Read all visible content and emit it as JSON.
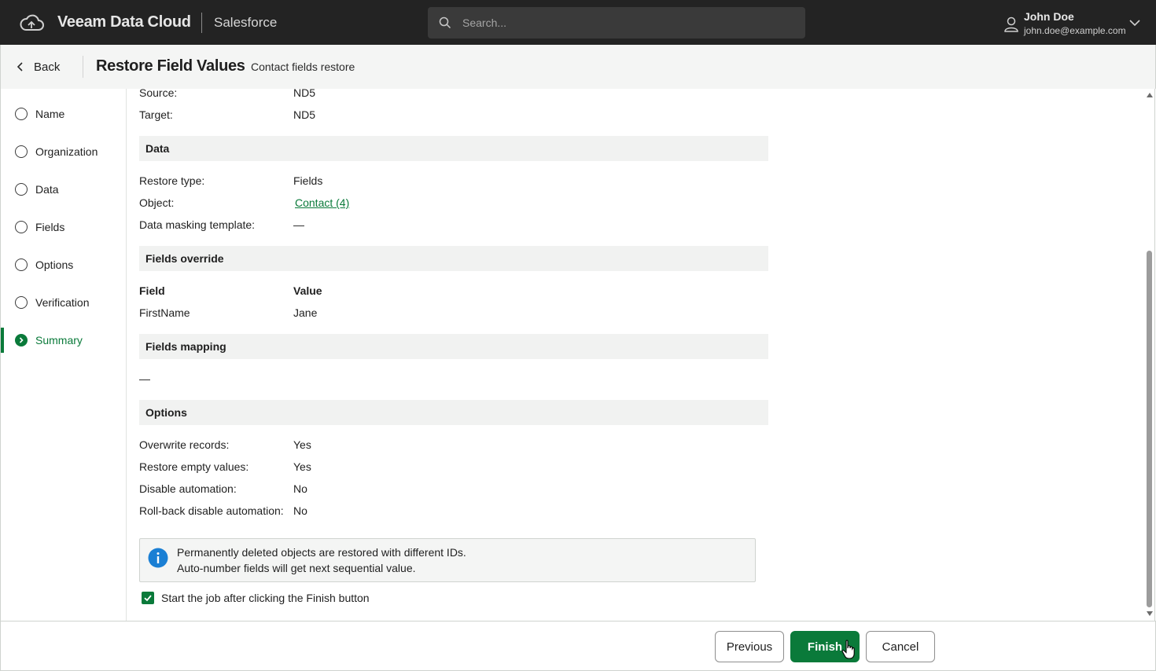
{
  "topbar": {
    "brand": "Veeam Data Cloud",
    "product": "Salesforce",
    "search_placeholder": "Search...",
    "user_name": "John Doe",
    "user_email": "john.doe@example.com"
  },
  "header": {
    "back_label": "Back",
    "title": "Restore Field Values",
    "subtitle": "Contact fields restore"
  },
  "steps": [
    {
      "label": "Name",
      "active": false
    },
    {
      "label": "Organization",
      "active": false
    },
    {
      "label": "Data",
      "active": false
    },
    {
      "label": "Fields",
      "active": false
    },
    {
      "label": "Options",
      "active": false
    },
    {
      "label": "Verification",
      "active": false
    },
    {
      "label": "Summary",
      "active": true
    }
  ],
  "summary": {
    "source": {
      "key": "Source:",
      "value": "ND5"
    },
    "target": {
      "key": "Target:",
      "value": "ND5"
    },
    "data_section": "Data",
    "restore_type": {
      "key": "Restore type:",
      "value": "Fields"
    },
    "object": {
      "key": "Object:",
      "value": "Contact (4)"
    },
    "masking": {
      "key": "Data masking template:",
      "value": "—"
    },
    "override_section": "Fields override",
    "override_headers": {
      "field": "Field",
      "value": "Value"
    },
    "override_rows": [
      {
        "field": "FirstName",
        "value": "Jane"
      }
    ],
    "mapping_section": "Fields mapping",
    "mapping_value": "—",
    "options_section": "Options",
    "overwrite": {
      "key": "Overwrite records:",
      "value": "Yes"
    },
    "empty_values": {
      "key": "Restore empty values:",
      "value": "Yes"
    },
    "disable_automation": {
      "key": "Disable automation:",
      "value": "No"
    },
    "rollback_automation": {
      "key": "Roll-back disable automation:",
      "value": "No"
    }
  },
  "info": {
    "line1": "Permanently deleted objects are restored with different IDs.",
    "line2": "Auto-number fields will get next sequential value."
  },
  "start_job": {
    "label": "Start the job after clicking the Finish button",
    "checked": true
  },
  "footer": {
    "previous_label": "Previous",
    "finish_label": "Finish",
    "cancel_label": "Cancel"
  },
  "colors": {
    "accent": "#0a7a3a",
    "topbar": "#232323",
    "info": "#1a7fd4"
  }
}
